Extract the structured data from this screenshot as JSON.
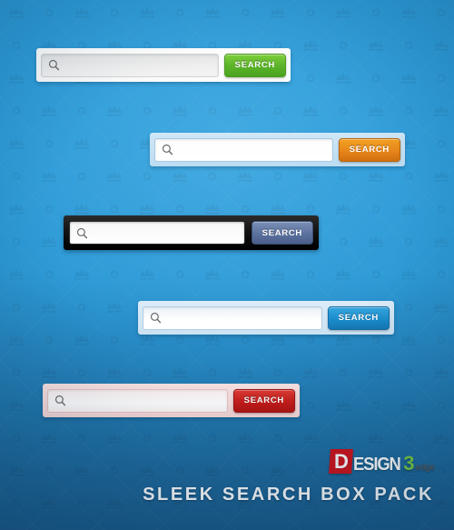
{
  "page": {
    "title": "SLEEK SEARCH BOX PACK",
    "background_color": "#2a9ad8",
    "pattern": "crown-and-circle-tile"
  },
  "logo": {
    "letter_d": "D",
    "word": "ESIGN",
    "digit": "3",
    "suffix": "edge",
    "colors": {
      "d_box": "#cf1118",
      "word": "#ffffff",
      "digit": "#7ac943",
      "suffix": "#4f5a62"
    }
  },
  "search_boxes": [
    {
      "id": "search-box-light-green",
      "style_name": "Light Grey with Green Button",
      "icon": "magnifier-icon",
      "input_value": "",
      "input_placeholder": "",
      "button_label": "SEARCH",
      "button_color": "#5cb32a",
      "container_color": "#ffffff",
      "field_color": "#efefef"
    },
    {
      "id": "search-box-blue-orange",
      "style_name": "Pale Blue with Orange Button",
      "icon": "magnifier-icon",
      "input_value": "",
      "input_placeholder": "",
      "button_label": "SEARCH",
      "button_color": "#e8861a",
      "container_color": "#c6e2f4",
      "field_color": "#ffffff"
    },
    {
      "id": "search-box-black-slate",
      "style_name": "Black with Slate Blue Button",
      "icon": "magnifier-icon",
      "input_value": "",
      "input_placeholder": "",
      "button_label": "SEARCH",
      "button_color": "#5e74a0",
      "container_color": "#111111",
      "field_color": "#ffffff"
    },
    {
      "id": "search-box-lightblue-azure",
      "style_name": "Light Blue with Azure Button",
      "icon": "magnifier-icon",
      "input_value": "",
      "input_placeholder": "",
      "button_label": "SEARCH",
      "button_color": "#1b8ccb",
      "container_color": "#d4e8f6",
      "field_color": "#ffffff"
    },
    {
      "id": "search-box-pink-red",
      "style_name": "Pink with Red Button",
      "icon": "magnifier-icon",
      "input_value": "",
      "input_placeholder": "",
      "button_label": "SEARCH",
      "button_color": "#c81b18",
      "container_color": "#f8dcdc",
      "field_color": "#ffffff"
    }
  ]
}
